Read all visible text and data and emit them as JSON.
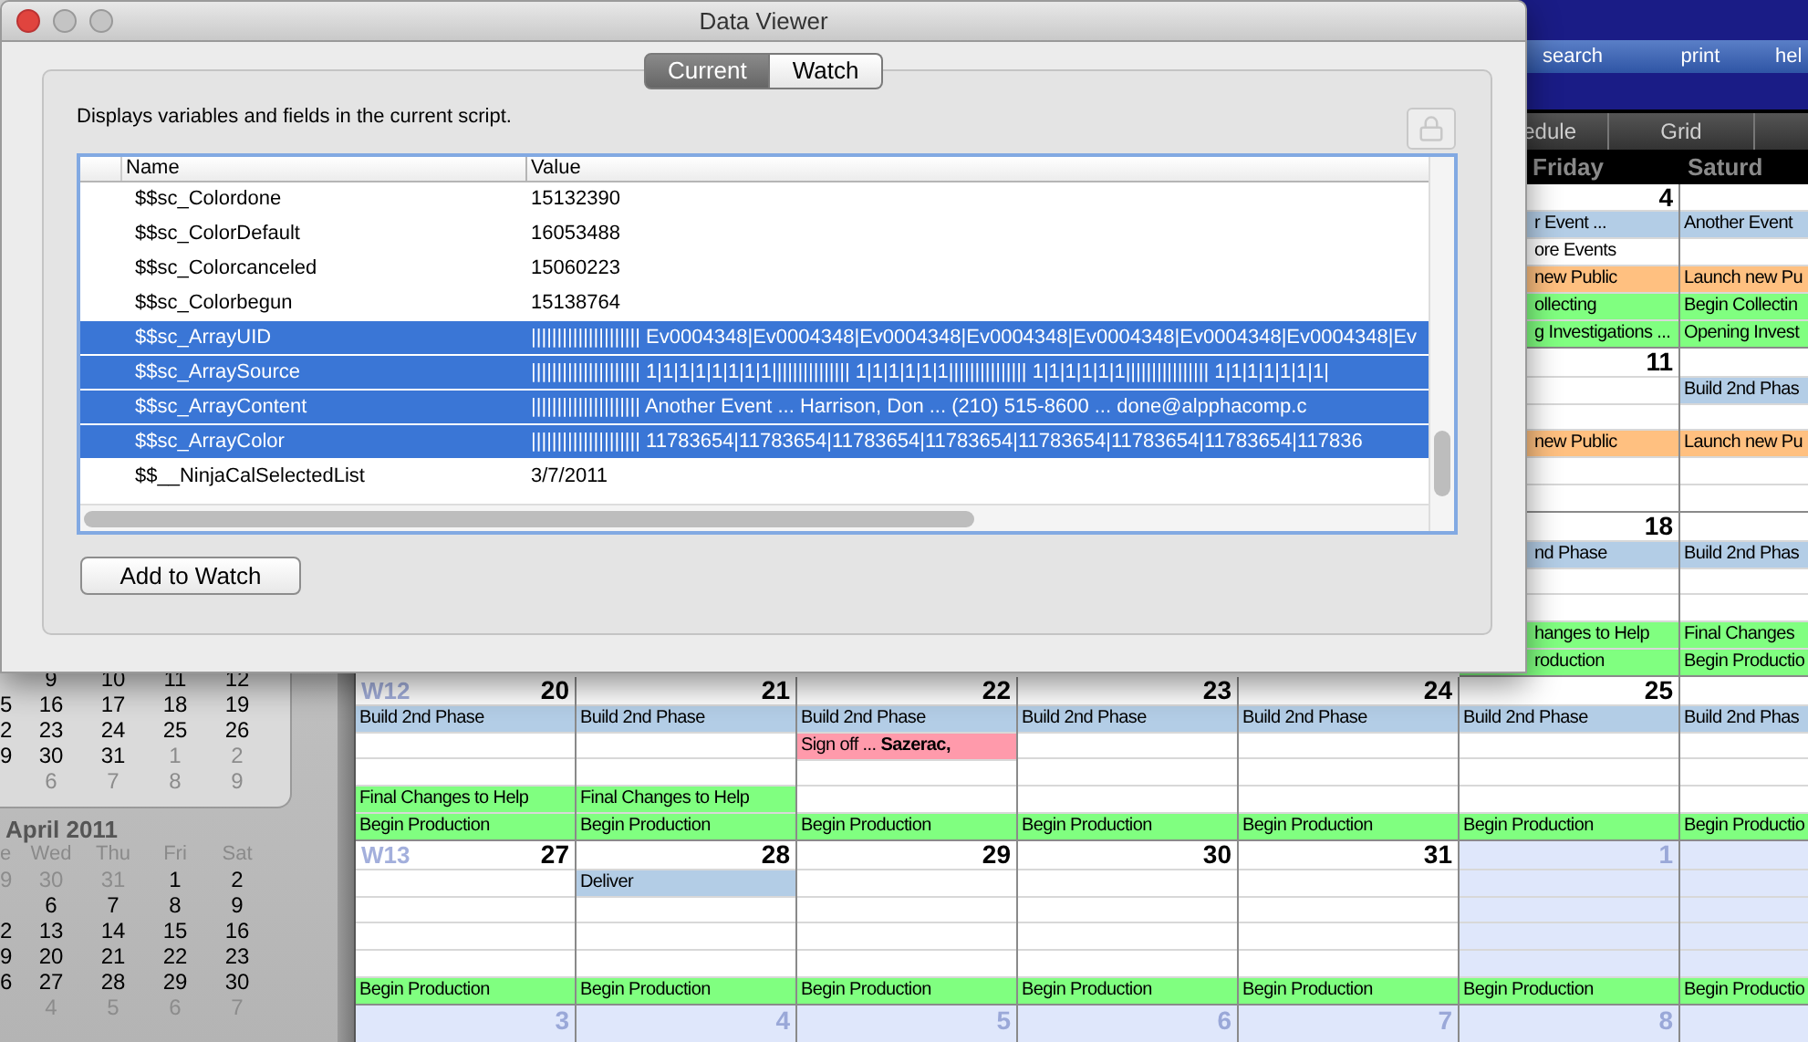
{
  "dialog": {
    "title": "Data Viewer",
    "tabs": [
      {
        "label": "Current",
        "selected": true
      },
      {
        "label": "Watch",
        "selected": false
      }
    ],
    "description": "Displays variables and fields in the current script.",
    "columns": [
      "Name",
      "Value"
    ],
    "rows": [
      {
        "name": "$$sc_Colordone",
        "value": "15132390",
        "selected": false
      },
      {
        "name": "$$sc_ColorDefault",
        "value": "16053488",
        "selected": false
      },
      {
        "name": "$$sc_Colorcanceled",
        "value": "15060223",
        "selected": false
      },
      {
        "name": "$$sc_Colorbegun",
        "value": "15138764",
        "selected": false
      },
      {
        "name": "$$sc_ArrayUID",
        "value": "||||||||||||||||||||| Ev0004348|Ev0004348|Ev0004348|Ev0004348|Ev0004348|Ev0004348|Ev0004348|Ev",
        "selected": true
      },
      {
        "name": "$$sc_ArraySource",
        "value": "||||||||||||||||||||| 1|1|1|1|1|1|1|1||||||||||||||| 1|1|1|1|1|1||||||||||||||| 1|1|1|1|1|1|||||||||||||||| 1|1|1|1|1|1|1|",
        "selected": true
      },
      {
        "name": "$$sc_ArrayContent",
        "value": "||||||||||||||||||||| Another Event ... Harrison, Don ... (210) 515-8600 ... done@alpphacomp.c",
        "selected": true
      },
      {
        "name": "$$sc_ArrayColor",
        "value": "||||||||||||||||||||| 11783654|11783654|11783654|11783654|11783654|11783654|11783654|117836",
        "selected": true
      },
      {
        "name": "$$__NinjaCalSelectedList",
        "value": "3/7/2011",
        "selected": false
      }
    ],
    "button": "Add to Watch"
  },
  "sidebar": {
    "march": {
      "rows": [
        {
          "cells": [
            {
              "text": "9",
              "muted": false
            },
            {
              "text": "10",
              "muted": false
            },
            {
              "text": "11",
              "muted": false
            },
            {
              "text": "12",
              "muted": false
            }
          ]
        },
        {
          "cut": {
            "text": "5",
            "muted": false
          },
          "cells": [
            {
              "text": "16",
              "muted": false
            },
            {
              "text": "17",
              "muted": false
            },
            {
              "text": "18",
              "muted": false
            },
            {
              "text": "19",
              "muted": false
            }
          ]
        },
        {
          "cut": {
            "text": "2",
            "muted": false
          },
          "cells": [
            {
              "text": "23",
              "muted": false
            },
            {
              "text": "24",
              "muted": false
            },
            {
              "text": "25",
              "muted": false
            },
            {
              "text": "26",
              "muted": false
            }
          ]
        },
        {
          "cut": {
            "text": "9",
            "muted": false
          },
          "cells": [
            {
              "text": "30",
              "muted": false
            },
            {
              "text": "31",
              "muted": false
            },
            {
              "text": "1",
              "muted": true
            },
            {
              "text": "2",
              "muted": true
            }
          ]
        },
        {
          "cells": [
            {
              "text": "6",
              "muted": true
            },
            {
              "text": "7",
              "muted": true
            },
            {
              "text": "8",
              "muted": true
            },
            {
              "text": "9",
              "muted": true
            }
          ]
        }
      ]
    },
    "april": {
      "title": "April 2011",
      "cut_header": "e",
      "headers": [
        "Wed",
        "Thu",
        "Fri",
        "Sat"
      ],
      "rows": [
        {
          "cut": {
            "text": "9",
            "muted": true
          },
          "cells": [
            {
              "text": "30",
              "muted": true
            },
            {
              "text": "31",
              "muted": true
            },
            {
              "text": "1",
              "muted": false
            },
            {
              "text": "2",
              "muted": false
            }
          ]
        },
        {
          "cells": [
            {
              "text": "6",
              "muted": false
            },
            {
              "text": "7",
              "muted": false
            },
            {
              "text": "8",
              "muted": false
            },
            {
              "text": "9",
              "muted": false
            }
          ]
        },
        {
          "cut": {
            "text": "2",
            "muted": false
          },
          "cells": [
            {
              "text": "13",
              "muted": false
            },
            {
              "text": "14",
              "muted": false
            },
            {
              "text": "15",
              "muted": false
            },
            {
              "text": "16",
              "muted": false
            }
          ]
        },
        {
          "cut": {
            "text": "9",
            "muted": false
          },
          "cells": [
            {
              "text": "20",
              "muted": false
            },
            {
              "text": "21",
              "muted": false
            },
            {
              "text": "22",
              "muted": false
            },
            {
              "text": "23",
              "muted": false
            }
          ]
        },
        {
          "cut": {
            "text": "6",
            "muted": false
          },
          "cells": [
            {
              "text": "27",
              "muted": false
            },
            {
              "text": "28",
              "muted": false
            },
            {
              "text": "29",
              "muted": false
            },
            {
              "text": "30",
              "muted": false
            }
          ]
        },
        {
          "cells": [
            {
              "text": "4",
              "muted": true
            },
            {
              "text": "5",
              "muted": true
            },
            {
              "text": "6",
              "muted": true
            },
            {
              "text": "7",
              "muted": true
            }
          ]
        }
      ]
    }
  },
  "menu": [
    "search",
    "print",
    "hel"
  ],
  "view_tabs": [
    "edule",
    "Grid"
  ],
  "day_headers": [
    "Friday",
    "Saturd"
  ],
  "weeks": [
    {
      "days": [
        {
          "day": "4",
          "muted": false,
          "events": [
            {
              "kind": "event",
              "text": "r Event ...",
              "color": "#b3cde6"
            },
            {
              "kind": "event",
              "text": "ore Events",
              "color": "#ffffff"
            },
            {
              "kind": "event",
              "text": "new Public",
              "color": "#ffc080"
            },
            {
              "kind": "event",
              "text": "ollecting",
              "color": "#80ff80"
            },
            {
              "kind": "event",
              "text": "g Investigations ...",
              "color": "#80ff80"
            }
          ]
        },
        {
          "muted": false,
          "events": [
            {
              "kind": "event",
              "text": "Another Event",
              "color": "#b3cde6"
            },
            {
              "kind": "blank"
            },
            {
              "kind": "event",
              "text": "Launch new Pu",
              "color": "#ffc080"
            },
            {
              "kind": "event",
              "text": "Begin Collectin",
              "color": "#80ff80"
            },
            {
              "kind": "event",
              "text": "Opening Invest",
              "color": "#80ff80"
            }
          ]
        }
      ]
    },
    {
      "days": [
        {
          "day": "11",
          "muted": false,
          "events": [
            {
              "kind": "blank"
            },
            {
              "kind": "blank"
            },
            {
              "kind": "event",
              "text": "new Public",
              "color": "#ffc080"
            },
            {
              "kind": "blank"
            },
            {
              "kind": "blank"
            }
          ]
        },
        {
          "muted": false,
          "events": [
            {
              "kind": "event",
              "text": "Build 2nd Phas",
              "color": "#b3cde6"
            },
            {
              "kind": "blank"
            },
            {
              "kind": "event",
              "text": "Launch new Pu",
              "color": "#ffc080"
            },
            {
              "kind": "blank"
            },
            {
              "kind": "blank"
            }
          ]
        }
      ]
    },
    {
      "days": [
        {
          "day": "18",
          "muted": false,
          "events": [
            {
              "kind": "event",
              "text": "nd Phase",
              "color": "#b3cde6"
            },
            {
              "kind": "blank"
            },
            {
              "kind": "blank"
            },
            {
              "kind": "event",
              "text": "hanges to Help",
              "color": "#80ff80"
            },
            {
              "kind": "event",
              "text": "roduction",
              "color": "#80ff80"
            }
          ]
        },
        {
          "muted": false,
          "events": [
            {
              "kind": "event",
              "text": "Build 2nd Phas",
              "color": "#b3cde6"
            },
            {
              "kind": "blank"
            },
            {
              "kind": "blank"
            },
            {
              "kind": "event",
              "text": "Final Changes",
              "color": "#80ff80"
            },
            {
              "kind": "event",
              "text": "Begin Productio",
              "color": "#80ff80"
            }
          ]
        }
      ]
    },
    {
      "days": [
        {
          "week": "W12",
          "day": "20",
          "muted": false,
          "events": [
            {
              "kind": "event",
              "text": "Build 2nd Phase",
              "color": "#b3cde6"
            },
            {
              "kind": "blank"
            },
            {
              "kind": "blank"
            },
            {
              "kind": "event",
              "text": "Final Changes to Help",
              "color": "#80ff80"
            },
            {
              "kind": "event",
              "text": "Begin Production",
              "color": "#80ff80"
            }
          ]
        },
        {
          "day": "21",
          "muted": false,
          "events": [
            {
              "kind": "event",
              "text": "Build 2nd Phase",
              "color": "#b3cde6"
            },
            {
              "kind": "blank"
            },
            {
              "kind": "blank"
            },
            {
              "kind": "event",
              "text": "Final Changes to Help",
              "color": "#80ff80"
            },
            {
              "kind": "event",
              "text": "Begin Production",
              "color": "#80ff80"
            }
          ]
        },
        {
          "day": "22",
          "muted": false,
          "events": [
            {
              "kind": "event",
              "text": "Build 2nd Phase",
              "color": "#b3cde6"
            },
            {
              "kind": "event",
              "text": "Sign off ... **Sazerac,**",
              "color": "#ff9aab"
            },
            {
              "kind": "blank"
            },
            {
              "kind": "blank"
            },
            {
              "kind": "event",
              "text": "Begin Production",
              "color": "#80ff80"
            }
          ]
        },
        {
          "day": "23",
          "muted": false,
          "events": [
            {
              "kind": "event",
              "text": "Build 2nd Phase",
              "color": "#b3cde6"
            },
            {
              "kind": "blank"
            },
            {
              "kind": "blank"
            },
            {
              "kind": "blank"
            },
            {
              "kind": "event",
              "text": "Begin Production",
              "color": "#80ff80"
            }
          ]
        },
        {
          "day": "24",
          "muted": false,
          "events": [
            {
              "kind": "event",
              "text": "Build 2nd Phase",
              "color": "#b3cde6"
            },
            {
              "kind": "blank"
            },
            {
              "kind": "blank"
            },
            {
              "kind": "blank"
            },
            {
              "kind": "event",
              "text": "Begin Production",
              "color": "#80ff80"
            }
          ]
        },
        {
          "day": "25",
          "muted": false,
          "events": [
            {
              "kind": "event",
              "text": "Build 2nd Phase",
              "color": "#b3cde6"
            },
            {
              "kind": "blank"
            },
            {
              "kind": "blank"
            },
            {
              "kind": "blank"
            },
            {
              "kind": "event",
              "text": "Begin Production",
              "color": "#80ff80"
            }
          ]
        },
        {
          "muted": false,
          "events": [
            {
              "kind": "event",
              "text": "Build 2nd Phas",
              "color": "#b3cde6"
            },
            {
              "kind": "blank"
            },
            {
              "kind": "blank"
            },
            {
              "kind": "blank"
            },
            {
              "kind": "event",
              "text": "Begin Productio",
              "color": "#80ff80"
            }
          ]
        }
      ]
    },
    {
      "days": [
        {
          "week": "W13",
          "day": "27",
          "muted": false,
          "events": [
            {
              "kind": "blank"
            },
            {
              "kind": "blank"
            },
            {
              "kind": "blank"
            },
            {
              "kind": "blank"
            },
            {
              "kind": "event",
              "text": "Begin Production",
              "color": "#80ff80"
            }
          ]
        },
        {
          "day": "28",
          "muted": false,
          "events": [
            {
              "kind": "event",
              "text": "Deliver",
              "color": "#b3cde6"
            },
            {
              "kind": "blank"
            },
            {
              "kind": "blank"
            },
            {
              "kind": "blank"
            },
            {
              "kind": "event",
              "text": "Begin Production",
              "color": "#80ff80"
            }
          ]
        },
        {
          "day": "29",
          "muted": false,
          "events": [
            {
              "kind": "blank"
            },
            {
              "kind": "blank"
            },
            {
              "kind": "blank"
            },
            {
              "kind": "blank"
            },
            {
              "kind": "event",
              "text": "Begin Production",
              "color": "#80ff80"
            }
          ]
        },
        {
          "day": "30",
          "muted": false,
          "events": [
            {
              "kind": "blank"
            },
            {
              "kind": "blank"
            },
            {
              "kind": "blank"
            },
            {
              "kind": "blank"
            },
            {
              "kind": "event",
              "text": "Begin Production",
              "color": "#80ff80"
            }
          ]
        },
        {
          "day": "31",
          "muted": false,
          "events": [
            {
              "kind": "blank"
            },
            {
              "kind": "blank"
            },
            {
              "kind": "blank"
            },
            {
              "kind": "blank"
            },
            {
              "kind": "event",
              "text": "Begin Production",
              "color": "#80ff80"
            }
          ]
        },
        {
          "day": "1",
          "muted": true,
          "events": [
            {
              "kind": "blank"
            },
            {
              "kind": "blank"
            },
            {
              "kind": "blank"
            },
            {
              "kind": "blank"
            },
            {
              "kind": "event",
              "text": "Begin Production",
              "color": "#80ff80"
            }
          ]
        },
        {
          "muted": true,
          "events": [
            {
              "kind": "blank"
            },
            {
              "kind": "blank"
            },
            {
              "kind": "blank"
            },
            {
              "kind": "blank"
            },
            {
              "kind": "event",
              "text": "Begin Productio",
              "color": "#80ff80"
            }
          ]
        }
      ]
    },
    {
      "days": [
        {
          "day": "3",
          "muted": true
        },
        {
          "day": "4",
          "muted": true
        },
        {
          "day": "5",
          "muted": true
        },
        {
          "day": "6",
          "muted": true
        },
        {
          "day": "7",
          "muted": true
        },
        {
          "day": "8",
          "muted": true
        },
        {
          "muted": true
        }
      ]
    }
  ]
}
